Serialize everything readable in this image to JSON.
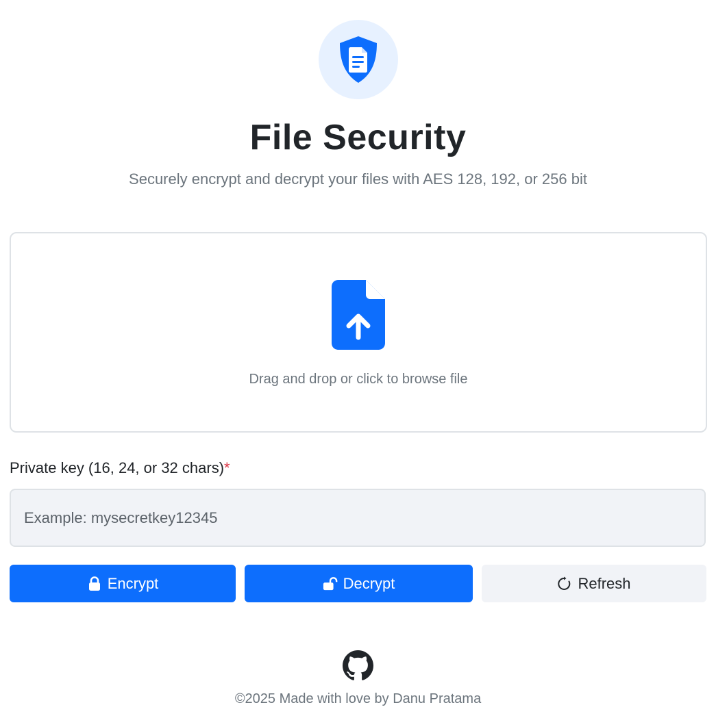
{
  "header": {
    "logo_icon": "shield-document-icon",
    "title": "File Security",
    "subtitle": "Securely encrypt and decrypt your files with AES 128, 192, or 256 bit"
  },
  "dropzone": {
    "icon": "file-upload-icon",
    "text": "Drag and drop or click to browse file"
  },
  "key": {
    "label": "Private key (16, 24, or 32 chars)",
    "required_mark": "*",
    "placeholder": "Example: mysecretkey12345",
    "value": ""
  },
  "actions": {
    "encrypt": {
      "label": "Encrypt",
      "icon": "lock-icon"
    },
    "decrypt": {
      "label": "Decrypt",
      "icon": "unlock-icon"
    },
    "refresh": {
      "label": "Refresh",
      "icon": "refresh-icon"
    }
  },
  "footer": {
    "github_icon": "github-icon",
    "text": "©2025 Made with love by Danu Pratama"
  },
  "colors": {
    "primary": "#0d6efd",
    "logo_bg": "#e7f1ff",
    "muted_text": "#6c757d",
    "required": "#dc3545",
    "light_button": "#f1f3f7"
  }
}
